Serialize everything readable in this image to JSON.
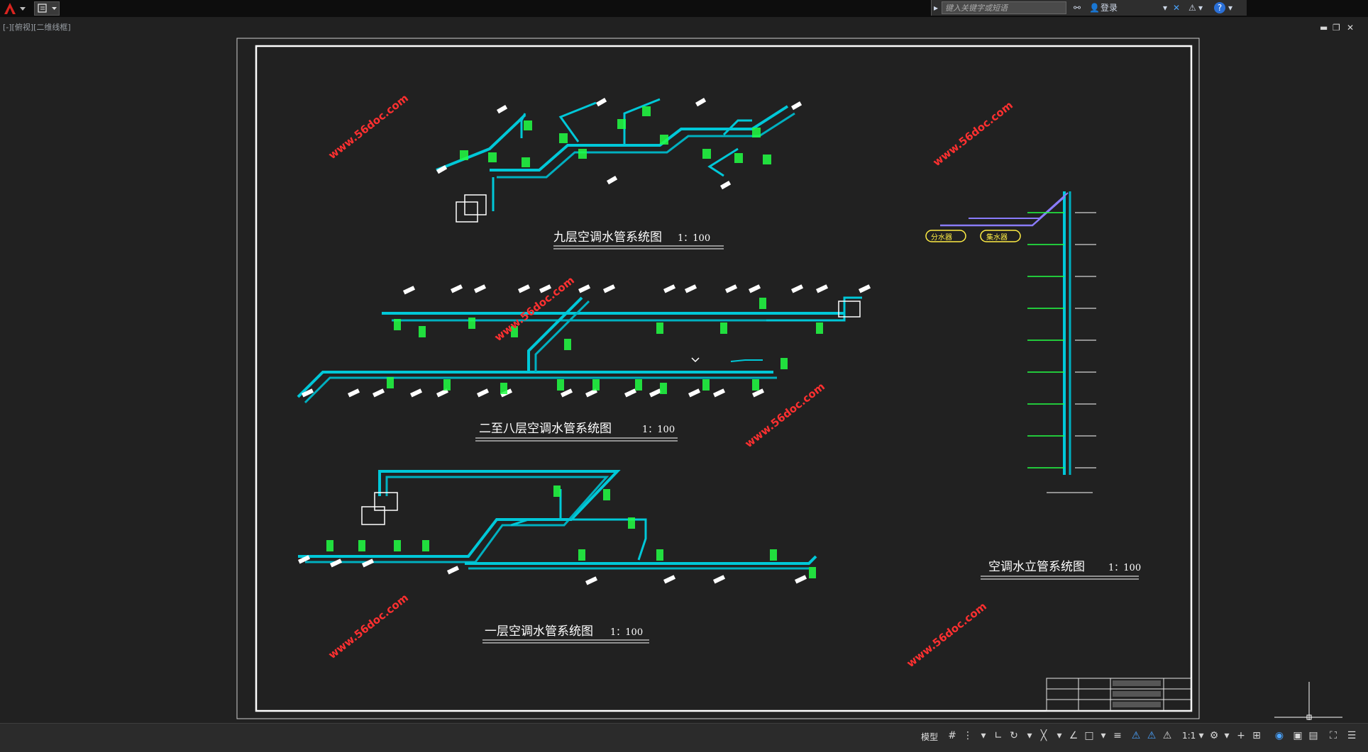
{
  "search": {
    "placeholder": "键入关键字或短语"
  },
  "toolbar": {
    "login_label": "登录"
  },
  "viewport": {
    "label": "[-][俯视][二维线框]"
  },
  "drawing_titles": {
    "floor9": "九层空调水管系统图",
    "floor9_scale": "1：100",
    "floor2_8": "二至八层空调水管系统图",
    "floor2_8_scale": "1：100",
    "floor1": "一层空调水管系统图",
    "floor1_scale": "1：100",
    "riser": "空调水立管系统图",
    "riser_scale": "1：100"
  },
  "legend": {
    "supply": "分水器",
    "return": "集水器"
  },
  "watermark": "www.56doc.com",
  "status": {
    "model_label": "模型",
    "scale": "1:1"
  },
  "colors": {
    "pipe": "#00c8d8",
    "label": "#22ff44",
    "frame": "#ffffff",
    "accent": "#8a7cff",
    "legend": "#ffee44",
    "watermark": "#ff3030"
  }
}
